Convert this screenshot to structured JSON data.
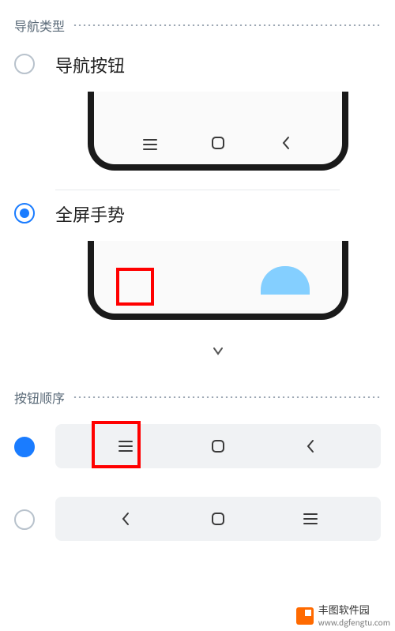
{
  "sections": {
    "navType": {
      "title": "导航类型"
    },
    "buttonOrder": {
      "title": "按钮顺序"
    }
  },
  "options": {
    "navButtons": {
      "label": "导航按钮"
    },
    "fullscreenGestures": {
      "label": "全屏手势"
    }
  },
  "icons": {
    "recents": "recents-icon",
    "home": "home-icon",
    "back": "back-icon"
  },
  "watermark": {
    "name": "丰图软件园",
    "url": "www.dgfengtu.com"
  }
}
